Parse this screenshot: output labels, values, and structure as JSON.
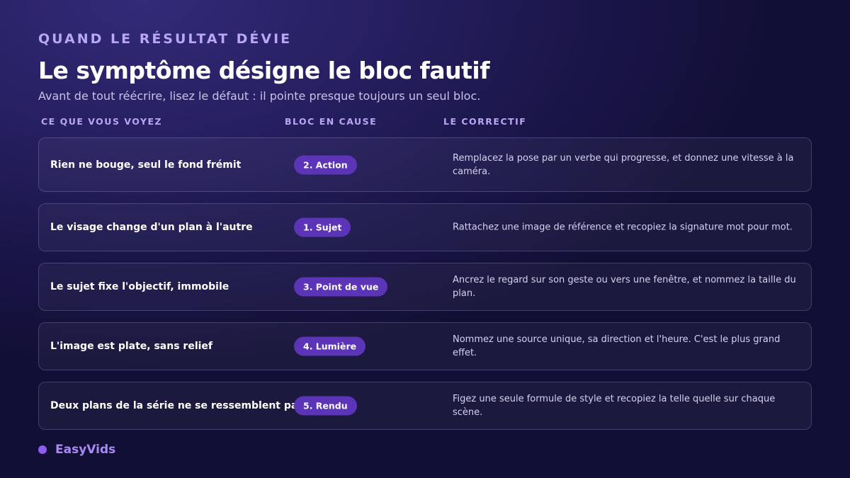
{
  "header": {
    "eyebrow": "QUAND LE RÉSULTAT DÉVIE",
    "title": "Le symptôme désigne le bloc fautif",
    "subtitle": "Avant de tout réécrire, lisez le défaut : il pointe presque toujours un seul bloc."
  },
  "columns": {
    "symptom": "CE QUE VOUS VOYEZ",
    "block": "BLOC EN CAUSE",
    "fix": "LE CORRECTIF"
  },
  "rows": [
    {
      "symptom": "Rien ne bouge, seul le fond frémit",
      "block": "2. Action",
      "fix": "Remplacez la pose par un verbe qui progresse, et donnez une vitesse à la caméra."
    },
    {
      "symptom": "Le visage change d'un plan à l'autre",
      "block": "1. Sujet",
      "fix": "Rattachez une image de référence et recopiez la signature mot pour mot."
    },
    {
      "symptom": "Le sujet fixe l'objectif, immobile",
      "block": "3. Point de vue",
      "fix": "Ancrez le regard sur son geste ou vers une fenêtre, et nommez la taille du plan."
    },
    {
      "symptom": "L'image est plate, sans relief",
      "block": "4. Lumière",
      "fix": "Nommez une source unique, sa direction et l'heure. C'est le plus grand effet."
    },
    {
      "symptom": "Deux plans de la série ne se ressemblent pas",
      "block": "5. Rendu",
      "fix": "Figez une seule formule de style et recopiez la telle quelle sur chaque scène."
    }
  ],
  "brand": {
    "name": "EasyVids",
    "accent": "#8e5cf0"
  },
  "colors": {
    "pill": "#5b34b8",
    "eyebrow": "#b9a7f5"
  }
}
